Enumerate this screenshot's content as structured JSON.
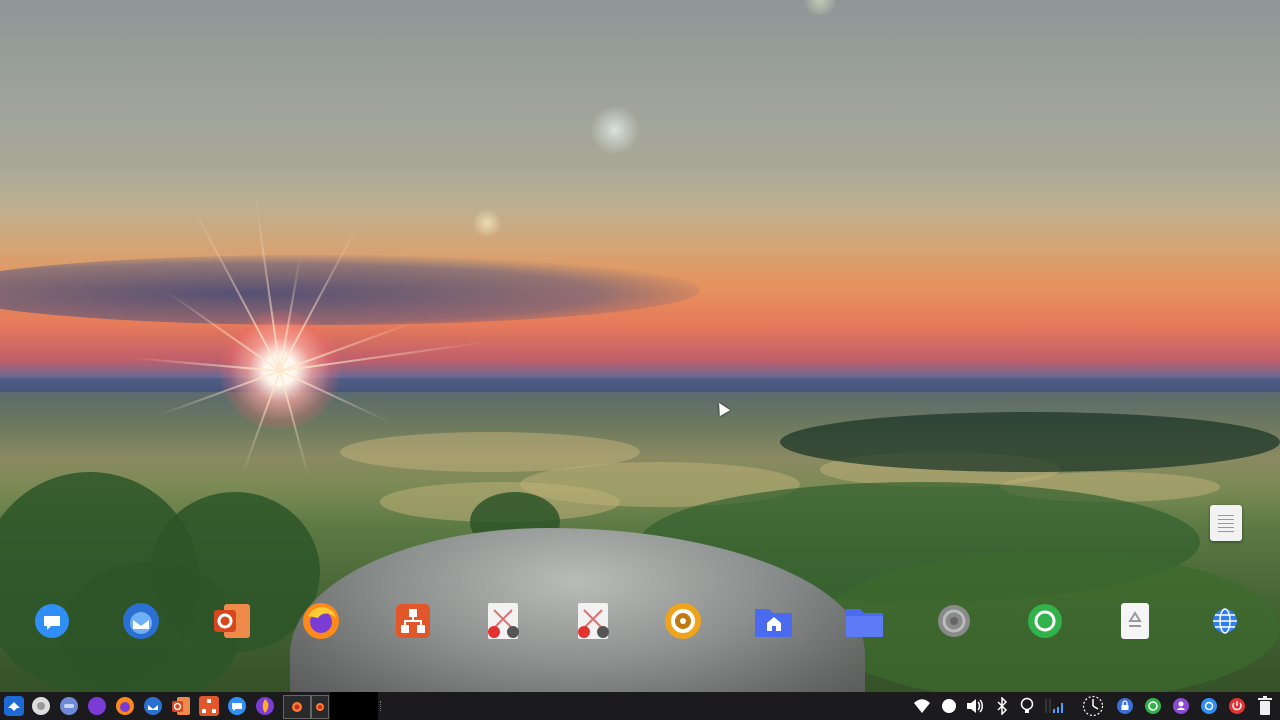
{
  "desktop": {
    "icons": [
      {
        "name": "messaging-app-icon",
        "color": "#2f8ff5"
      },
      {
        "name": "thunderbird-mail-icon",
        "color": "#2a6fd1"
      },
      {
        "name": "office-outlook-icon",
        "color": "#e2572a"
      },
      {
        "name": "firefox-icon",
        "color": "#ff7a2a"
      },
      {
        "name": "network-share-icon",
        "color": "#e2572a"
      },
      {
        "name": "broken-app-icon",
        "color": "#f0f0f0"
      },
      {
        "name": "broken-app-icon",
        "color": "#f0f0f0"
      },
      {
        "name": "media-disc-icon",
        "color": "#f0a41c"
      },
      {
        "name": "home-folder-icon",
        "color": "#4a6bf0"
      },
      {
        "name": "folder-icon",
        "color": "#4a6bf0"
      },
      {
        "name": "camera-shutter-icon",
        "color": "#8a8a8a"
      },
      {
        "name": "circle-app-icon",
        "color": "#31b24a"
      },
      {
        "name": "recycle-bin-icon",
        "color": "#f5f5f5"
      },
      {
        "name": "web-globe-icon",
        "color": "#2f7ff0"
      }
    ],
    "note_widget": "text-file-icon"
  },
  "taskbar": {
    "launchers": [
      {
        "name": "start-menu-icon",
        "color": "#1d6ad6"
      },
      {
        "name": "chrome-icon",
        "color": "#dddddd"
      },
      {
        "name": "chat-app-icon",
        "color": "#6e8ad6"
      },
      {
        "name": "purple-app-icon",
        "color": "#7b3cd6"
      },
      {
        "name": "firefox-icon",
        "color": "#ff7a2a"
      },
      {
        "name": "thunderbird-icon",
        "color": "#2a6fd1"
      },
      {
        "name": "outlook-icon",
        "color": "#e2572a"
      },
      {
        "name": "network-share-icon",
        "color": "#e2572a"
      },
      {
        "name": "messaging-icon",
        "color": "#2f8ff5"
      },
      {
        "name": "firefox-dev-icon",
        "color": "#d84a8a"
      }
    ],
    "windows": [
      {
        "name": "window-preview-firefox",
        "color": "#ff7a2a"
      },
      {
        "name": "window-preview-firefox-2",
        "color": "#ff7a2a"
      }
    ],
    "tray": [
      {
        "name": "wifi-icon",
        "color": "#ffffff"
      },
      {
        "name": "notification-bubble-icon",
        "color": "#ffffff"
      },
      {
        "name": "volume-icon",
        "color": "#ffffff"
      },
      {
        "name": "bluetooth-icon",
        "color": "#ffffff"
      },
      {
        "name": "lightbulb-icon",
        "color": "#ffffff"
      },
      {
        "name": "system-monitor-icon",
        "color": "#4aa0ff"
      },
      {
        "name": "clock-icon",
        "color": "#ffffff"
      },
      {
        "name": "lock-icon",
        "color": "#3b6fd8"
      },
      {
        "name": "refresh-icon",
        "color": "#31b24a"
      },
      {
        "name": "switch-user-icon",
        "color": "#8a4ad6"
      },
      {
        "name": "settings-icon",
        "color": "#2f8ff5"
      },
      {
        "name": "power-icon",
        "color": "#e23232"
      },
      {
        "name": "trash-icon",
        "color": "#f0f0f0"
      }
    ]
  }
}
